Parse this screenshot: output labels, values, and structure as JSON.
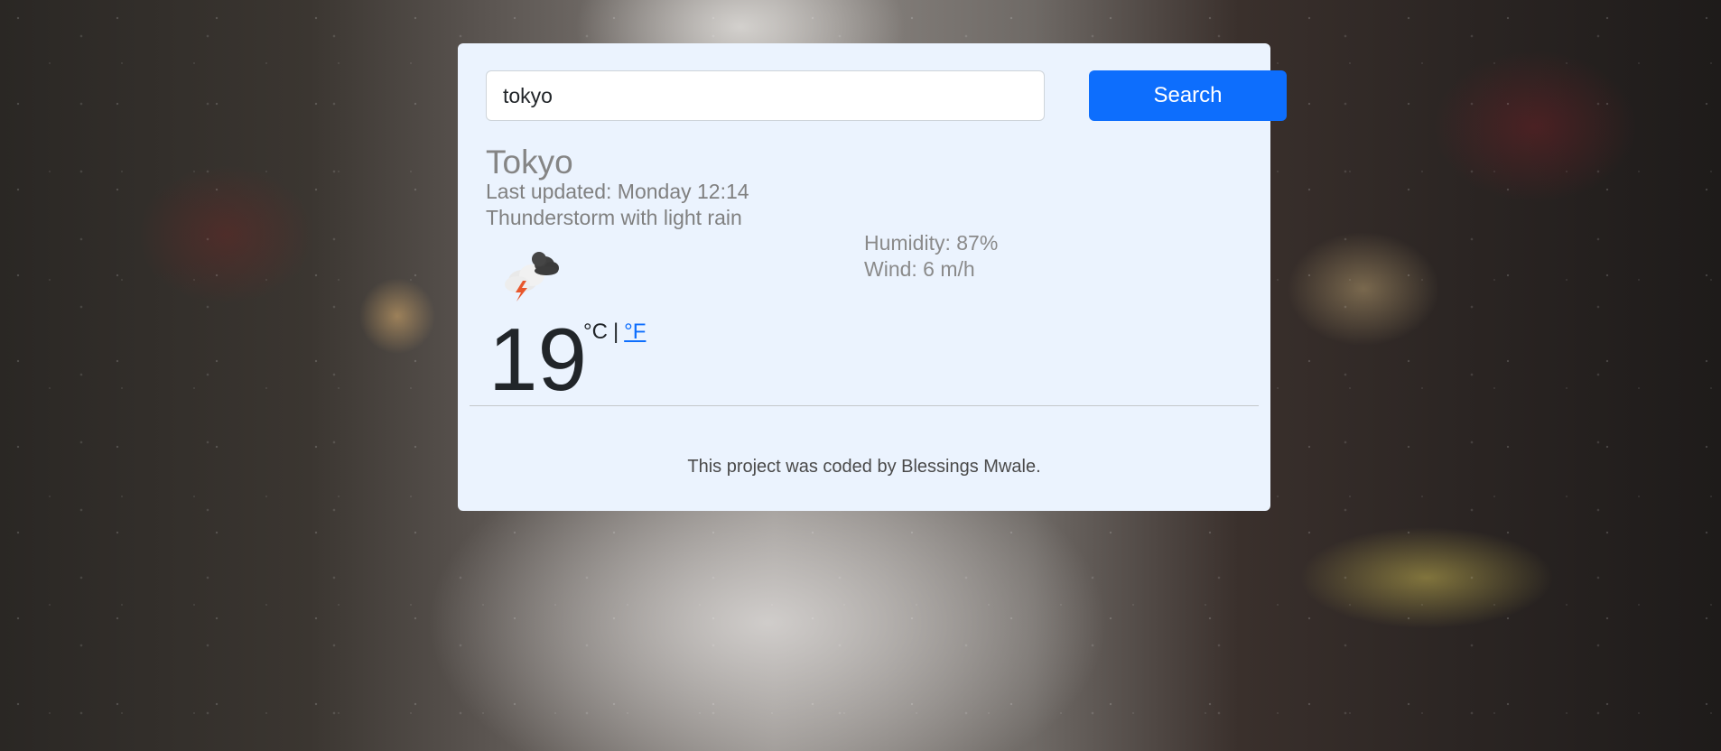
{
  "search": {
    "value": "tokyo",
    "button_label": "Search"
  },
  "weather": {
    "city": "Tokyo",
    "last_updated": "Last updated: Monday 12:14",
    "description": "Thunderstorm with light rain",
    "humidity": "Humidity: 87%",
    "wind": "Wind: 6 m/h",
    "icon": "thunderstorm-rain-icon",
    "temperature": "19",
    "unit_celsius": "°C",
    "unit_separator": "|",
    "unit_fahrenheit": "°F"
  },
  "footer": {
    "credit": "This project was coded by Blessings Mwale."
  },
  "colors": {
    "accent": "#0d6efd",
    "card_background": "#ebf3fe",
    "muted_text": "#858585"
  }
}
